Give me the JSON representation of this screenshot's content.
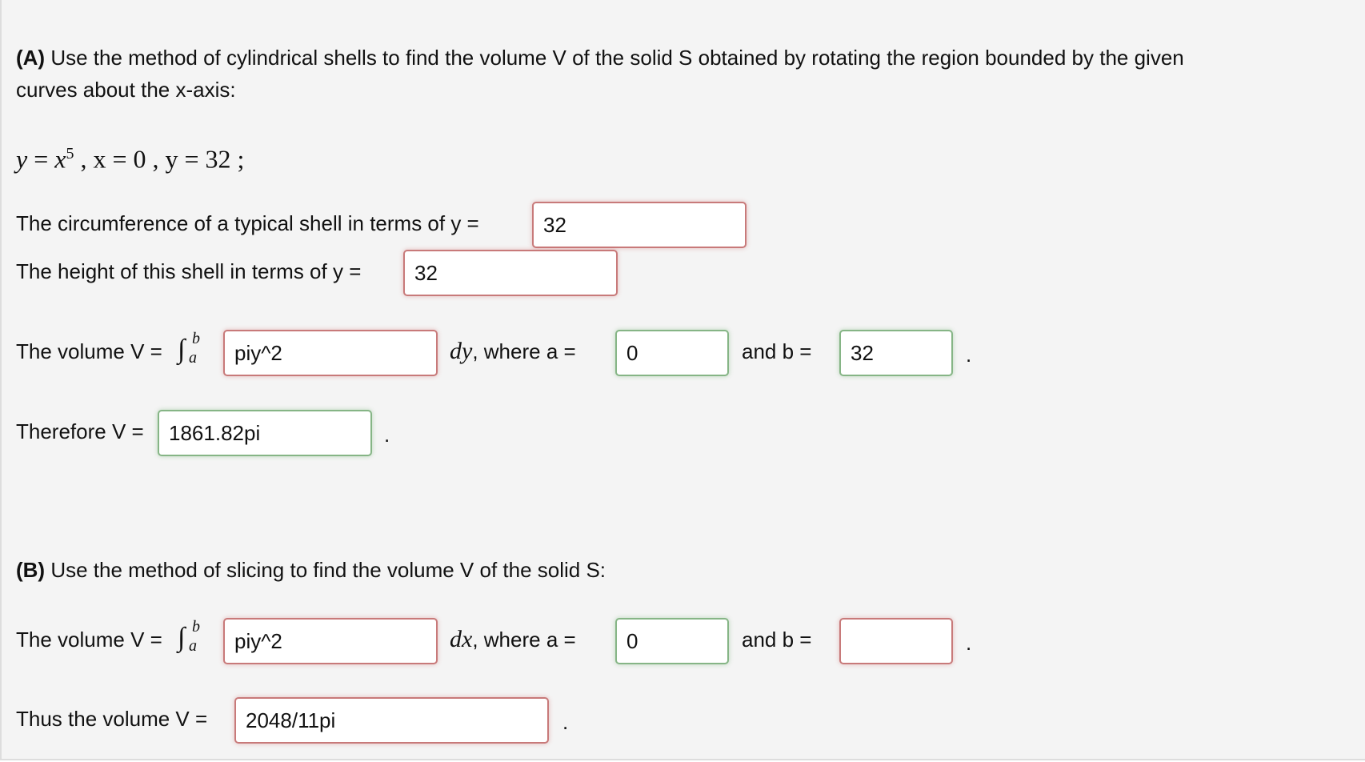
{
  "partA": {
    "prefix": "(A)",
    "intro": " Use the method of cylindrical shells to find the volume V of the solid S obtained by rotating the region bounded by the given",
    "intro2": "curves about the x-axis:",
    "equation": {
      "y": "y",
      "eq1": " = ",
      "x": "x",
      "exp": "5",
      "rest": " , x = 0 , y = 32 ;"
    },
    "circumference_label": "The circumference of a typical shell in terms of y =",
    "circumference_value": "32",
    "height_label": "The height of this shell in terms of y =",
    "height_value": "32",
    "volume_label": "The volume V =",
    "integrand_value": "piy^2",
    "differential": "dy",
    "where_a_label": ", where a =",
    "a_value": "0",
    "and_b_label": "and b =",
    "b_value": "32",
    "therefore_label": "Therefore V =",
    "therefore_value": "1861.82pi"
  },
  "partB": {
    "prefix": "(B)",
    "intro": " Use the method of slicing to find the volume V of the solid S:",
    "volume_label": "The volume V =",
    "integrand_value": "piy^2",
    "differential": "dx",
    "where_a_label": ", where a =",
    "a_value": "0",
    "and_b_label": "and b =",
    "b_value": "",
    "thus_label": "Thus the volume V =",
    "thus_value": "2048/11pi"
  },
  "integral": {
    "symbol": "∫",
    "upper": "b",
    "lower": "a"
  },
  "period": ".",
  "colors": {
    "incorrect": "#c87a7a",
    "correct": "#86b586",
    "background": "#f4f4f4"
  }
}
